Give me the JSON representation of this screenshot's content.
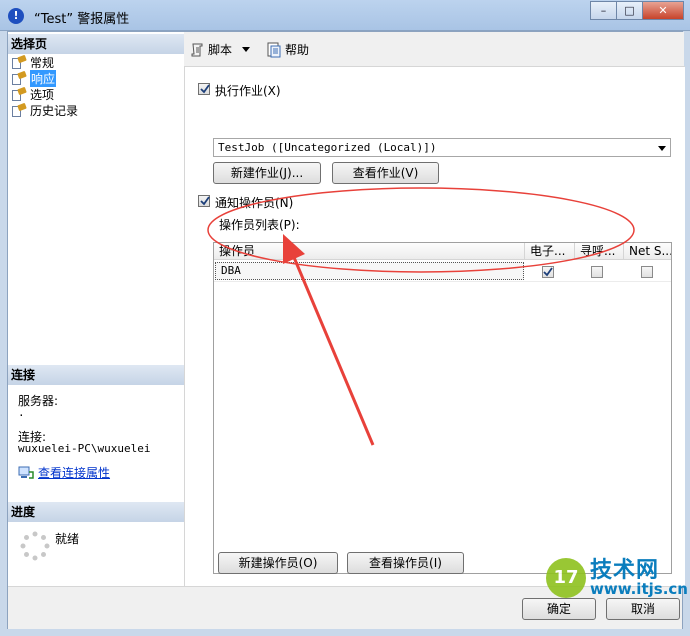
{
  "window": {
    "title": "“Test” 警报属性",
    "minimize_glyph": "–",
    "maximize_glyph": "□",
    "close_glyph": "✕"
  },
  "left_pane": {
    "select_page_header": "选择页",
    "pages": [
      {
        "label": "常规",
        "selected": false
      },
      {
        "label": "响应",
        "selected": true
      },
      {
        "label": "选项",
        "selected": false
      },
      {
        "label": "历史记录",
        "selected": false
      }
    ],
    "connection_header": "连接",
    "server_label": "服务器:",
    "server_value": ".",
    "connection_label": "连接:",
    "connection_value": "wuxuelei-PC\\wuxuelei",
    "view_connection_link": "查看连接属性",
    "progress_header": "进度",
    "progress_status": "就绪"
  },
  "toolbar": {
    "script_label": "脚本",
    "help_label": "帮助"
  },
  "response": {
    "execute_job_label": "执行作业(X)",
    "execute_job_checked": true,
    "job_value": "TestJob ([Uncategorized (Local)])",
    "new_job_button": "新建作业(J)...",
    "view_job_button": "查看作业(V)",
    "notify_operators_label": "通知操作员(N)",
    "notify_operators_checked": true,
    "operator_list_label": "操作员列表(P):",
    "columns": [
      "操作员",
      "电子...",
      "寻呼...",
      "Net S..."
    ],
    "rows": [
      {
        "operator": "DBA",
        "email": true,
        "pager": false,
        "net_send": false
      }
    ],
    "new_operator_button": "新建操作员(O)",
    "view_operator_button": "查看操作员(I)"
  },
  "footer": {
    "ok_button": "确定",
    "cancel_button": "取消"
  },
  "watermark": {
    "logo_text": "17",
    "brand": "技术网",
    "url": "www.itjs.cn"
  },
  "colors": {
    "selection": "#3399ff",
    "annotation_red": "#e8413a",
    "link": "#0033cc"
  }
}
